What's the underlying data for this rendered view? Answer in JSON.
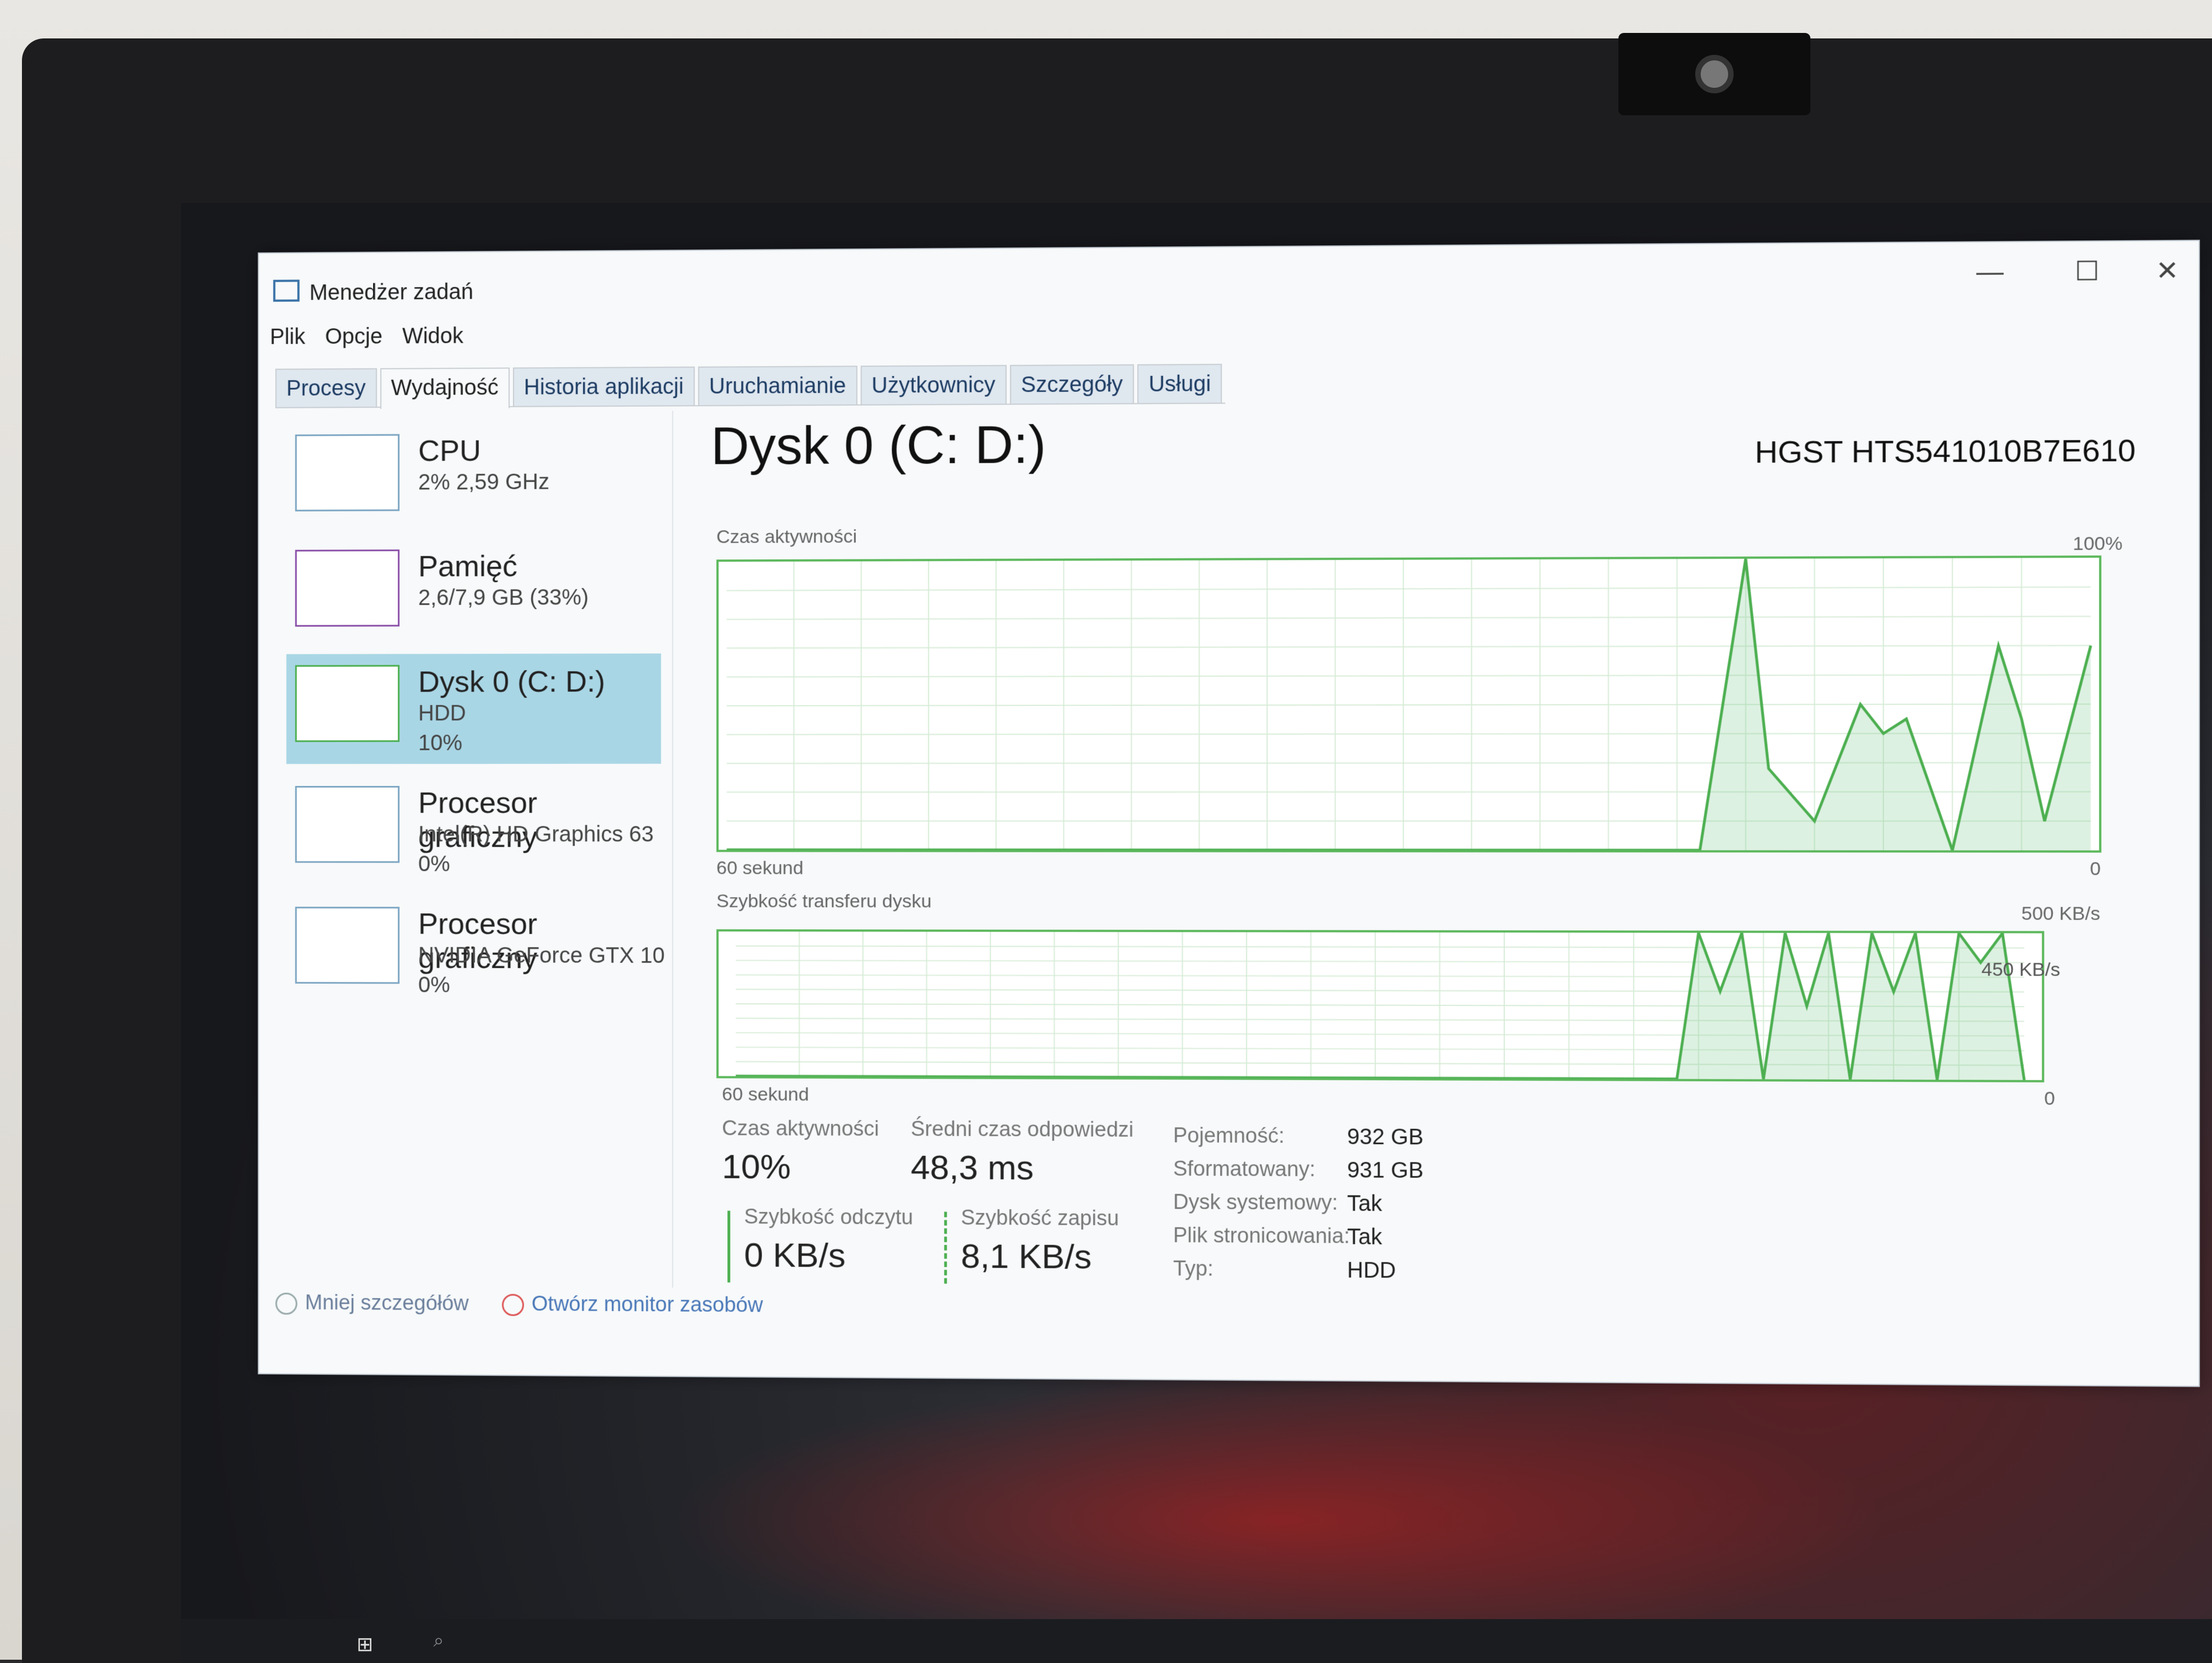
{
  "window": {
    "title": "Menedżer zadań",
    "controls": {
      "minimize": "—",
      "maximize": "☐",
      "close": "✕"
    }
  },
  "menu": [
    "Plik",
    "Opcje",
    "Widok"
  ],
  "tabs": [
    {
      "label": "Procesy",
      "active": false
    },
    {
      "label": "Wydajność",
      "active": true
    },
    {
      "label": "Historia aplikacji",
      "active": false
    },
    {
      "label": "Uruchamianie",
      "active": false
    },
    {
      "label": "Użytkownicy",
      "active": false
    },
    {
      "label": "Szczegóły",
      "active": false
    },
    {
      "label": "Usługi",
      "active": false
    }
  ],
  "resources": [
    {
      "title": "CPU",
      "sub": "2% 2,59 GHz",
      "sub2": ""
    },
    {
      "title": "Pamięć",
      "sub": "2,6/7,9 GB (33%)",
      "sub2": ""
    },
    {
      "title": "Dysk 0 (C: D:)",
      "sub": "HDD",
      "sub2": "10%",
      "selected": true
    },
    {
      "title": "Procesor graficzny",
      "sub": "Intel(R) HD Graphics 63",
      "sub2": "0%"
    },
    {
      "title": "Procesor graficzny",
      "sub": "NVIDIA GeForce GTX 10",
      "sub2": "0%"
    }
  ],
  "detail": {
    "title": "Dysk 0 (C: D:)",
    "model": "HGST HTS541010B7E610",
    "activity_chart": {
      "label": "Czas aktywności",
      "max": "100%",
      "min": "0",
      "time": "60 sekund"
    },
    "transfer_chart": {
      "label": "Szybkość transferu dysku",
      "max": "500 KB/s",
      "mid": "450 KB/s",
      "min": "0",
      "time": "60 sekund"
    },
    "stats": {
      "activity_label": "Czas aktywności",
      "activity_value": "10%",
      "response_label": "Średni czas odpowiedzi",
      "response_value": "48,3 ms",
      "read_label": "Szybkość odczytu",
      "read_value": "0 KB/s",
      "write_label": "Szybkość zapisu",
      "write_value": "8,1 KB/s"
    },
    "properties": [
      {
        "label": "Pojemność:",
        "value": "932 GB"
      },
      {
        "label": "Sformatowany:",
        "value": "931 GB"
      },
      {
        "label": "Dysk systemowy:",
        "value": "Tak"
      },
      {
        "label": "Plik stronicowania:",
        "value": "Tak"
      },
      {
        "label": "Typ:",
        "value": "HDD"
      }
    ]
  },
  "footer": {
    "less_details": "Mniej szczegółów",
    "resource_monitor": "Otwórz monitor zasobów"
  },
  "chart_data": [
    {
      "type": "area",
      "title": "Czas aktywności",
      "ylim": [
        0,
        100
      ],
      "x": [
        0,
        5,
        10,
        15,
        20,
        25,
        30,
        35,
        40,
        41,
        43,
        45,
        46,
        48,
        50,
        51,
        52,
        54,
        55,
        56,
        57,
        58,
        60
      ],
      "values": [
        0,
        0,
        0,
        0,
        0,
        0,
        0,
        0,
        0,
        0,
        0,
        100,
        28,
        10,
        50,
        40,
        45,
        0,
        35,
        70,
        45,
        10,
        70
      ]
    },
    {
      "type": "area",
      "title": "Szybkość transferu dysku",
      "ylim": [
        0,
        500
      ],
      "x": [
        0,
        10,
        20,
        30,
        40,
        41,
        42,
        43,
        44,
        45,
        46,
        47,
        48,
        49,
        50,
        51,
        52,
        53,
        54,
        55,
        56,
        57,
        58,
        59,
        60
      ],
      "values": [
        0,
        0,
        0,
        0,
        0,
        0,
        0,
        0,
        0,
        500,
        300,
        500,
        0,
        500,
        250,
        500,
        0,
        500,
        300,
        500,
        0,
        500,
        400,
        500,
        0
      ]
    }
  ]
}
